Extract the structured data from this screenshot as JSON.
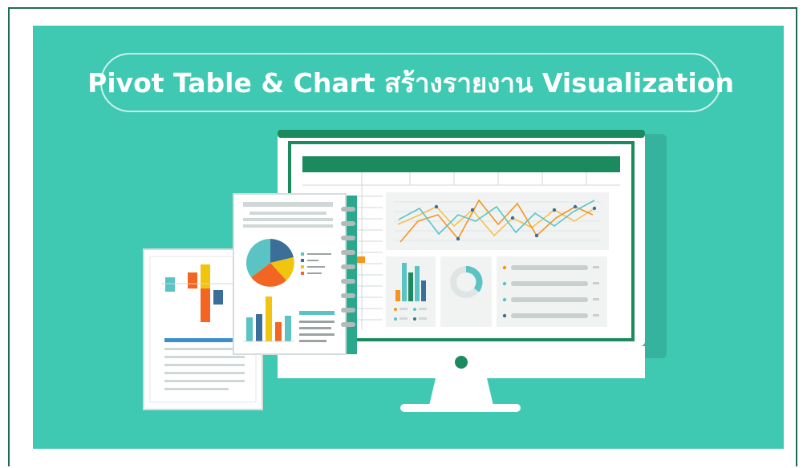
{
  "banner": {
    "title": "Pivot Table & Chart สร้างรายงาน Visualization",
    "background_color": "#3fc9b3"
  },
  "illustration": {
    "monitor_icon": "monitor-icon",
    "report_icon": "report-document-icon",
    "clipboard_icon": "pie-chart-clipboard-icon",
    "accent_colors": [
      "#1c8a5f",
      "#f7941d",
      "#f1c40f",
      "#3b6f99",
      "#5cc3c5",
      "#f26522"
    ]
  }
}
